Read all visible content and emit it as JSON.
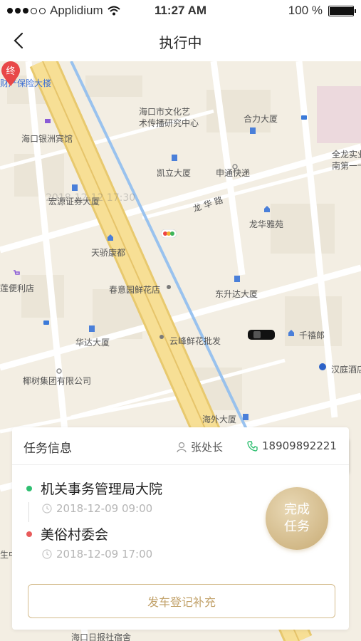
{
  "status_bar": {
    "carrier": "Applidium",
    "time": "11:27 AM",
    "battery_text": "100 %",
    "battery_level": 1.0,
    "signal_bars_filled": 3,
    "signal_bars_total": 5
  },
  "nav": {
    "title": "执行中",
    "back_icon": "chevron-left-icon"
  },
  "map": {
    "labels": {
      "insurance": "财产保险大楼",
      "culture_center_1": "海口市文化艺",
      "culture_center_2": "术传播研究中心",
      "heli_tower": "合力大厦",
      "yinzhou_hotel": "海口银洲宾馆",
      "quanlong_1": "全龙实业",
      "quanlong_2": "南第一卡",
      "kaili_tower": "凯立大厦",
      "shentong": "申通快递",
      "hongyuan": "宏源证券大厦",
      "ghost_timestamp": "2018-12-12  17:30",
      "longhua_road": "龙 华 路",
      "longhua_garden": "龙华雅苑",
      "tianyi": "天骄康都",
      "convenience": "莲便利店",
      "chunyi_flower": "春意园鲜花店",
      "dongsheng": "东升达大厦",
      "huada": "华达大厦",
      "yunfeng_flower": "云峰鲜花批发",
      "qianxilang": "千禧郎",
      "hanting": "汉庭酒店",
      "yeshu_group": "椰树集团有限公司",
      "haiwai": "海外大厦",
      "bottom_cut": "海口日报社宿舍",
      "side_cut": "生中"
    },
    "end_marker_label": "终",
    "locate_icon": "navigation-arrow-icon",
    "colors": {
      "background": "#f3eee3",
      "main_road": "#f4d98a",
      "route": "#9cc3f0",
      "end_marker": "#e84848"
    }
  },
  "task": {
    "header_title": "任务信息",
    "contact_name": "张处长",
    "contact_phone": "18909892221",
    "stops": [
      {
        "name": "机关事务管理局大院",
        "time": "2018-12-09   09:00",
        "color": "#2fbf71"
      },
      {
        "name": "美俗村委会",
        "time": "2018-12-09   17:00",
        "color": "#e85b5b"
      }
    ],
    "complete_button_line1": "完成",
    "complete_button_line2": "任务",
    "supplement_button": "发车登记补充",
    "accent_color": "#c8ab74"
  }
}
